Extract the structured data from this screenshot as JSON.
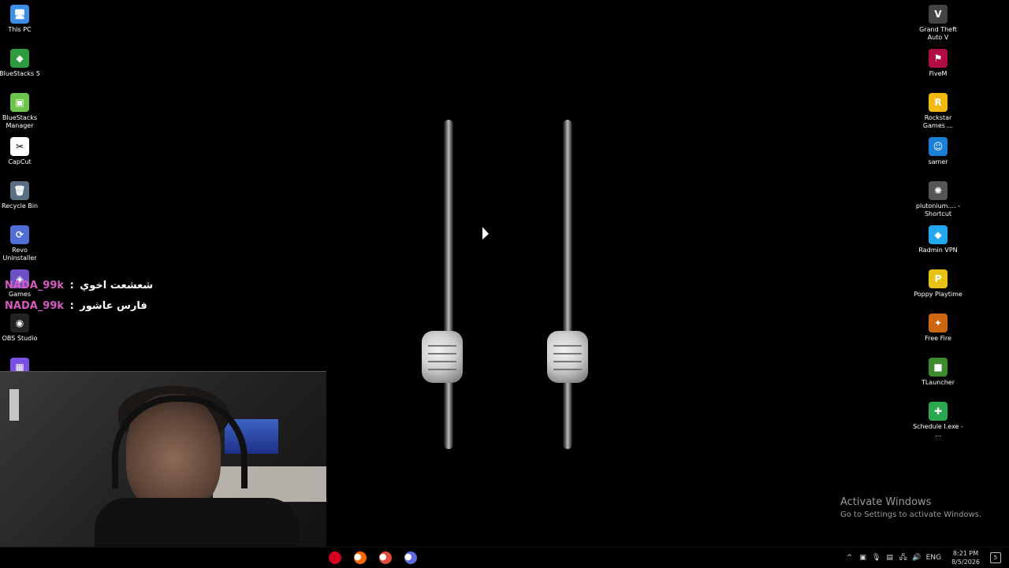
{
  "desktop": {
    "left_icons": [
      {
        "name": "This PC",
        "glyph": "🖥",
        "bg": "#3c8ee8"
      },
      {
        "name": "BlueStacks 5",
        "glyph": "◆",
        "bg": "#2f9b3f"
      },
      {
        "name": "BlueStacks Manager",
        "glyph": "▣",
        "bg": "#6ec54d"
      },
      {
        "name": "CapCut",
        "glyph": "✂",
        "bg": "#ffffff"
      },
      {
        "name": "Recycle Bin",
        "glyph": "🗑",
        "bg": "#5a6e85"
      },
      {
        "name": "Revo Uninstaller",
        "glyph": "⟳",
        "bg": "#4f6ed6"
      },
      {
        "name": "Games",
        "glyph": "◈",
        "bg": "#6d4fc5"
      },
      {
        "name": "OBS Studio",
        "glyph": "◉",
        "bg": "#222222"
      },
      {
        "name": "",
        "glyph": "▦",
        "bg": "#7a4fe6"
      }
    ],
    "right_icons": [
      {
        "name": "Grand Theft Auto V",
        "glyph": "V",
        "bg": "#444444"
      },
      {
        "name": "FiveM",
        "glyph": "⚑",
        "bg": "#b00d45"
      },
      {
        "name": "Rockstar Games ...",
        "glyph": "R",
        "bg": "#f2b90f"
      },
      {
        "name": "samer",
        "glyph": "☺",
        "bg": "#1c7fd6"
      },
      {
        "name": "plutonium.... - Shortcut",
        "glyph": "✺",
        "bg": "#555555"
      },
      {
        "name": "Radmin VPN",
        "glyph": "◆",
        "bg": "#23a8ef"
      },
      {
        "name": "Poppy Playtime",
        "glyph": "P",
        "bg": "#e7c114"
      },
      {
        "name": "Free Fire",
        "glyph": "✦",
        "bg": "#cc6611"
      },
      {
        "name": "TLauncher",
        "glyph": "■",
        "bg": "#3e8a2f"
      },
      {
        "name": "Schedule I.exe - ...",
        "glyph": "✚",
        "bg": "#2aa84f"
      }
    ]
  },
  "chat": [
    {
      "user": "NADA_99k",
      "sep": ":",
      "message": "شعشعت اخوي"
    },
    {
      "user": "NADA_99k",
      "sep": ":",
      "message": "فارس عاشور"
    }
  ],
  "watermark": {
    "title": "Activate Windows",
    "subtitle": "Go to Settings to activate Windows."
  },
  "taskbar": {
    "apps": [
      {
        "name": "app-partial",
        "glyph": "",
        "color": "#d30020"
      },
      {
        "name": "color-app",
        "glyph": "●",
        "color": "#ff6a00"
      },
      {
        "name": "chrome",
        "glyph": "●",
        "color": "#e14c3c"
      },
      {
        "name": "chrome-profile",
        "glyph": "●",
        "color": "#5e6ce0"
      }
    ],
    "tray": {
      "chevron": "^",
      "icons": [
        "▣",
        "🎙",
        "▤",
        "🖧",
        "🔊"
      ],
      "language": "ENG",
      "time": "8:21 PM",
      "date": "8/5/2026",
      "notifications": "5"
    }
  }
}
